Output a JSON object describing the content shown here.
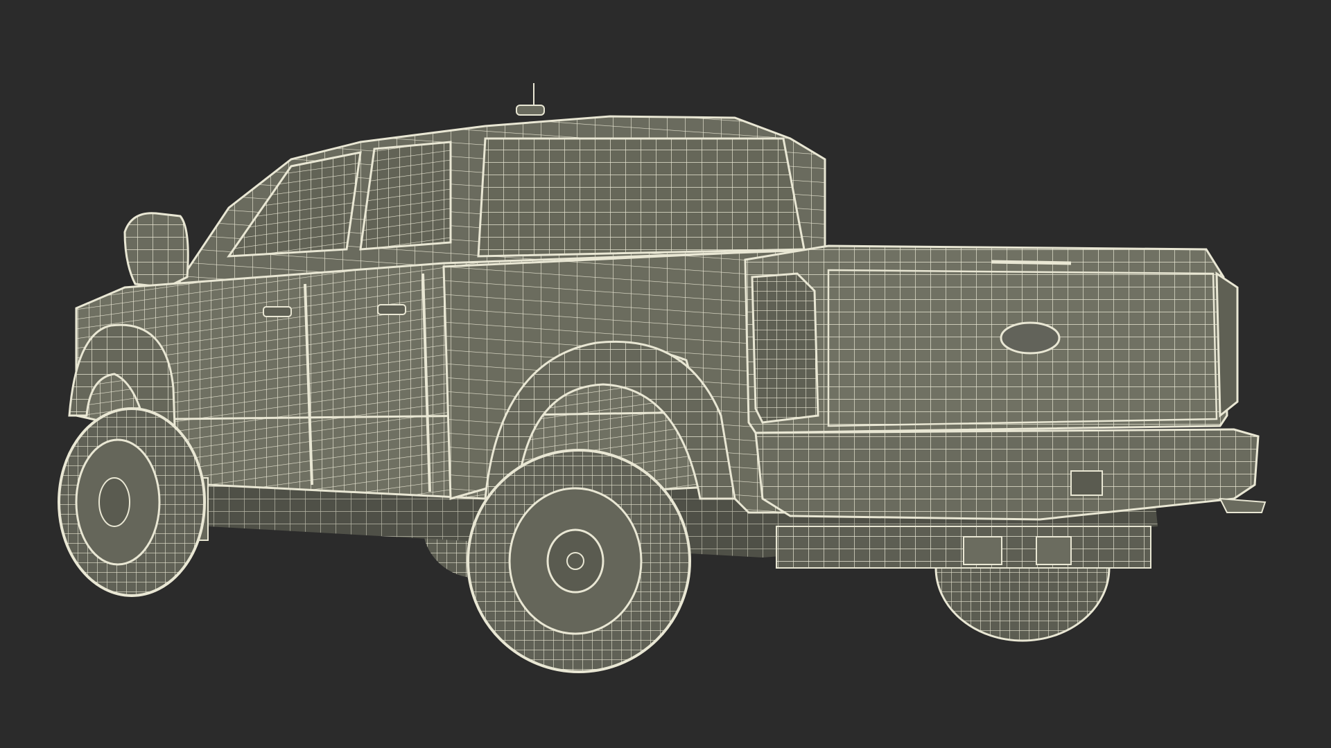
{
  "scene": {
    "subject_icon": "pickup-truck-wireframe-icon",
    "colors": {
      "background": "#2b2b2b",
      "body_fill": "#6f7062",
      "body_fill_dark": "#5f6054",
      "glass_fill": "#64655a",
      "tire_fill": "#606156",
      "wire": "#e9e7d4",
      "wire_faint": "#cfcdb8"
    }
  }
}
